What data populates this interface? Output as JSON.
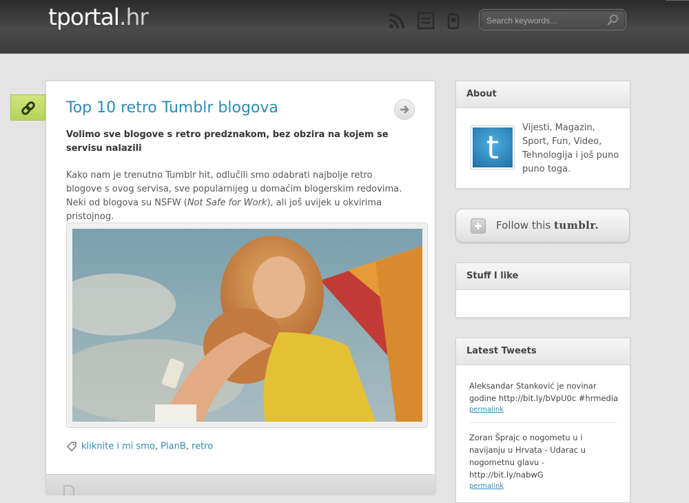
{
  "header": {
    "logo_main": "tportal",
    "logo_ext": ".hr",
    "icons": [
      "rss-icon",
      "newsletter-icon",
      "mobile-icon"
    ],
    "search_placeholder": "Search keywords..."
  },
  "post": {
    "type_icon": "link-icon",
    "title": "Top 10 retro Tumblr blogova",
    "lead": "Volimo sve blogove s retro predznakom, bez obzira na kojem se servisu nalazili",
    "body_before": "Kako nam je trenutno Tumblr hit, odlučili smo odabrati najbolje retro blogove s ovog servisa, sve popularnijeg u domaćim blogerskim redovima. Neki od blogova su NSFW (",
    "body_em": "Not Safe for Work",
    "body_after": "), ali još uvijek u okvirima pristojnog.",
    "tags": [
      "kliknite i mi smo",
      "PlanB",
      "retro"
    ],
    "tag_sep": ", "
  },
  "sidebar": {
    "about": {
      "title": "About",
      "avatar_letter": "t",
      "text": "Vijesti, Magazin, Sport, Fun, Video, Tehnologija i još puno puno toga."
    },
    "follow": {
      "label_prefix": "Follow this",
      "label_brand": "tumblr."
    },
    "stuff": {
      "title": "Stuff I like"
    },
    "tweets": {
      "title": "Latest Tweets",
      "items": [
        {
          "text": "Aleksandar Stanković je novinar godine http://bit.ly/bVpU0c #hrmedia",
          "link": "permalink"
        },
        {
          "text": "Zoran Šprajc o nogometu u i navijanju u Hrvata - Udarac u nogometnu glavu - http://bit.ly/nabwG",
          "link": "permalink"
        }
      ]
    }
  },
  "colors": {
    "accent_link": "#2e8bb5",
    "badge_green": "#b7d35a",
    "header_dark": "#3c3c3c"
  }
}
